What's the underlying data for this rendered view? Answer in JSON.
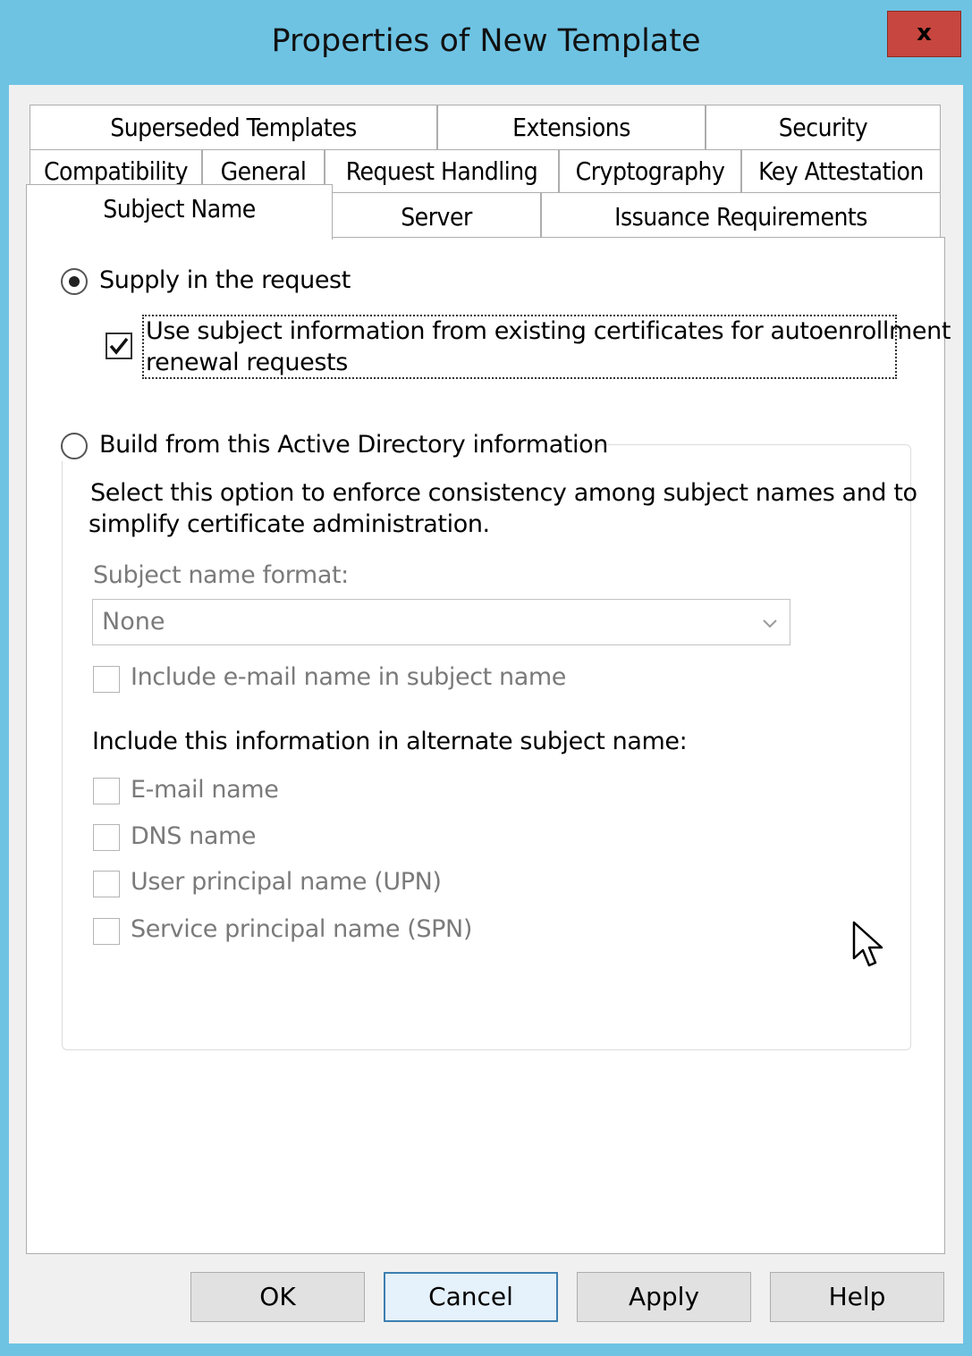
{
  "window": {
    "title": "Properties of New Template",
    "close_glyph": "x"
  },
  "tabs": {
    "row1": [
      "Superseded Templates",
      "Extensions",
      "Security"
    ],
    "row2": [
      "Compatibility",
      "General",
      "Request Handling",
      "Cryptography",
      "Key Attestation"
    ],
    "row3": [
      "Subject Name",
      "Server",
      "Issuance Requirements"
    ],
    "selected": "Subject Name"
  },
  "subject": {
    "supply": {
      "label": "Supply in the request",
      "selected": true
    },
    "use_existing": {
      "line1": "Use subject information from existing certificates for autoenrollment",
      "line2": "renewal requests",
      "checked": true
    },
    "build": {
      "label": "Build from this Active Directory information",
      "selected": false
    },
    "description": {
      "line1": "Select this option to enforce consistency among subject names and to",
      "line2": "simplify certificate administration."
    },
    "format_label": "Subject name format:",
    "format_value": "None",
    "include_email": "Include e-mail name in subject name",
    "alt_heading": "Include this information in alternate subject name:",
    "alt_options": [
      "E-mail name",
      "DNS name",
      "User principal name (UPN)",
      "Service principal name (SPN)"
    ]
  },
  "buttons": {
    "ok": "OK",
    "cancel": "Cancel",
    "apply": "Apply",
    "help": "Help"
  },
  "colors": {
    "frame": "#6ec3e3",
    "close": "#c7463f",
    "default_button_border": "#3c7fb1"
  },
  "icons": {
    "close": "close-icon",
    "dropdown": "chevron-down-icon",
    "check": "checkmark-icon",
    "cursor": "mouse-pointer-icon"
  }
}
